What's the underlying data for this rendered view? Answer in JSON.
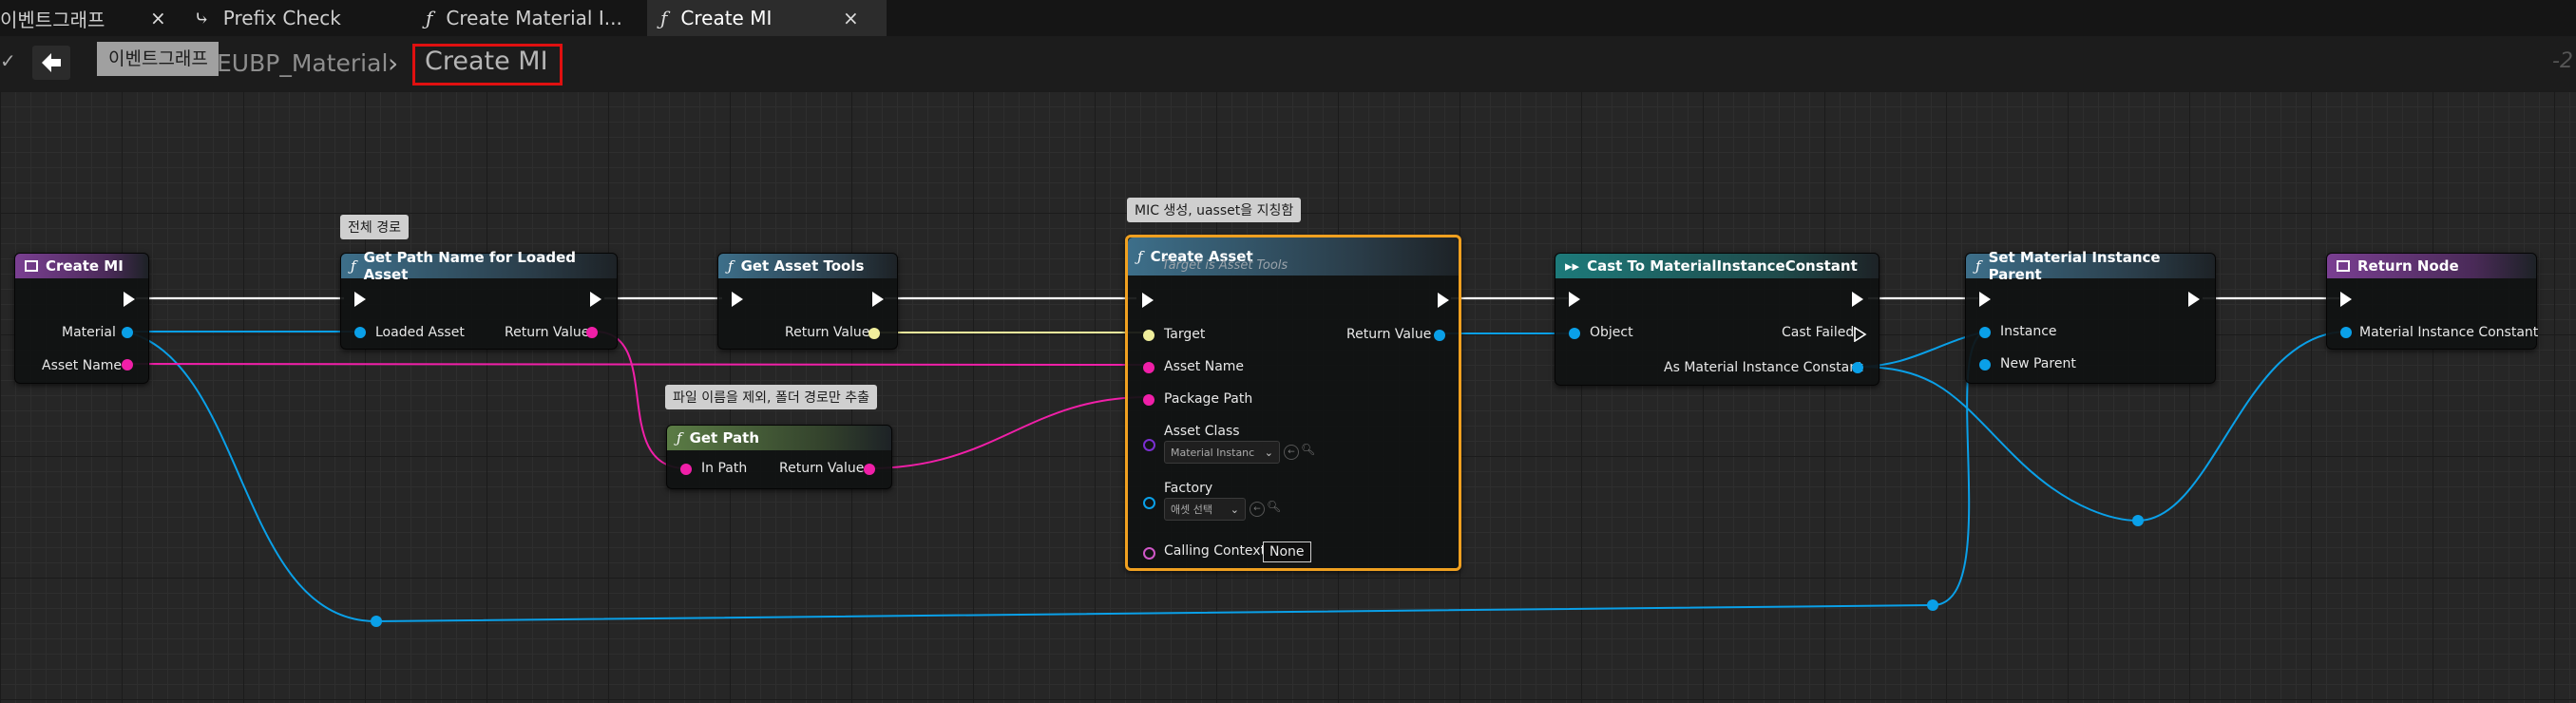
{
  "tabs": [
    {
      "label": "이벤트그래프",
      "icon": "",
      "close": "×"
    },
    {
      "label": "Prefix Check",
      "icon": "⤷"
    },
    {
      "label": "Create Material I...",
      "icon": "ƒ"
    },
    {
      "label": "Create MI",
      "icon": "ƒ",
      "close": "×"
    }
  ],
  "breadcrumb": {
    "tooltip": "이벤트그래프",
    "path": "EUBP_Material",
    "sep": "›",
    "current": "Create MI",
    "zoom": "-2"
  },
  "comments": {
    "full_path": "전체 경로",
    "path_only": "파일 이름을 제외, 폴더 경로만 추출",
    "mic": "MIC 생성, uasset을 지칭함"
  },
  "nodes": {
    "create_mi": {
      "title": "Create MI",
      "pins": [
        "Material",
        "Asset Name"
      ]
    },
    "get_path_name": {
      "title": "Get Path Name for Loaded Asset",
      "pins": [
        "Loaded Asset",
        "Return Value"
      ]
    },
    "get_asset_tools": {
      "title": "Get Asset Tools",
      "pins": [
        "Return Value"
      ]
    },
    "get_path": {
      "title": "Get Path",
      "pins": [
        "In Path",
        "Return Value"
      ]
    },
    "create_asset": {
      "title": "Create Asset",
      "subtitle": "Target is Asset Tools",
      "pins": [
        "Target",
        "Asset Name",
        "Package Path",
        "Asset Class",
        "Factory",
        "Calling Context",
        "Return Value"
      ],
      "asset_class_value": "Material Instanc",
      "factory_value": "애셋 선택",
      "calling_context_value": "None"
    },
    "cast": {
      "title": "Cast To MaterialInstanceConstant",
      "pins": [
        "Object",
        "Cast Failed",
        "As Material Instance Constant"
      ]
    },
    "set_parent": {
      "title": "Set Material Instance Parent",
      "pins": [
        "Instance",
        "New Parent"
      ]
    },
    "return_node": {
      "title": "Return Node",
      "pins": [
        "Material Instance Constant"
      ]
    }
  },
  "colors": {
    "object_pin": "#0aa0e8",
    "string_pin": "#f01fa8",
    "struct_pin": "#f0ee9c",
    "class_pin": "#7a2fd0",
    "selected_border": "#f0a020",
    "highlight_box": "#e01010"
  }
}
